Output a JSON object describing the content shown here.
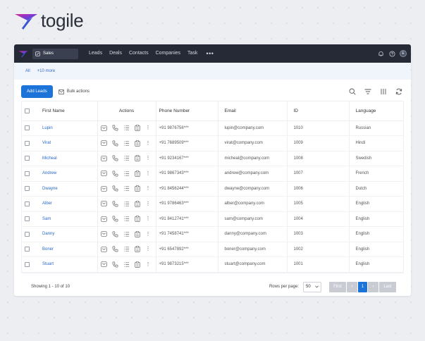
{
  "brand": {
    "name": "togile"
  },
  "topbar": {
    "app_selector": "Sales",
    "nav": [
      "Leads",
      "Deals",
      "Contacts",
      "Companies",
      "Task"
    ],
    "more": "•••",
    "avatar": "E"
  },
  "filters": {
    "all": "All",
    "more": "+10 more"
  },
  "toolbar": {
    "add_label": "Add Leads",
    "bulk_label": "Bulk actions"
  },
  "table": {
    "headers": {
      "name": "First Name",
      "actions": "Actions",
      "phone": "Phone Number",
      "email": "Email",
      "id": "ID",
      "language": "Language"
    },
    "rows": [
      {
        "name": "Lupin",
        "phone": "+91 9876756***",
        "email": "lupin@company.com",
        "id": "1010",
        "language": "Russian"
      },
      {
        "name": "Virat",
        "phone": "+91 7689509***",
        "email": "virat@company.com",
        "id": "1009",
        "language": "Hindi"
      },
      {
        "name": "Micheal",
        "phone": "+91 9234167***",
        "email": "micheal@company.com",
        "id": "1008",
        "language": "Swedish"
      },
      {
        "name": "Andrew",
        "phone": "+91 9867343***",
        "email": "andrew@company.com",
        "id": "1007",
        "language": "French"
      },
      {
        "name": "Dwayne",
        "phone": "+91 8456244***",
        "email": "dwayne@company.com",
        "id": "1006",
        "language": "Dutch"
      },
      {
        "name": "Alber",
        "phone": "+91 9786463***",
        "email": "alber@company.com",
        "id": "1005",
        "language": "English"
      },
      {
        "name": "Sam",
        "phone": "+91 8412741***",
        "email": "sam@company.com",
        "id": "1004",
        "language": "English"
      },
      {
        "name": "Danny",
        "phone": "+91 7458741***",
        "email": "danny@company.com",
        "id": "1003",
        "language": "English"
      },
      {
        "name": "Boner",
        "phone": "+91 6547892***",
        "email": "boner@company.com",
        "id": "1002",
        "language": "English"
      },
      {
        "name": "Stuart",
        "phone": "+91 9873215***",
        "email": "stuart@company.com",
        "id": "1001",
        "language": "English"
      }
    ]
  },
  "footer": {
    "showing": "Showing 1 - 10 of 10",
    "rows_per_page_label": "Rows per page:",
    "rows_per_page_value": "50",
    "pager": {
      "first": "First",
      "prev": "‹",
      "current": "1",
      "next": "›",
      "last": "Last"
    }
  },
  "colors": {
    "accent": "#1c73d8",
    "topbar": "#262a36",
    "link": "#2a68c4"
  }
}
